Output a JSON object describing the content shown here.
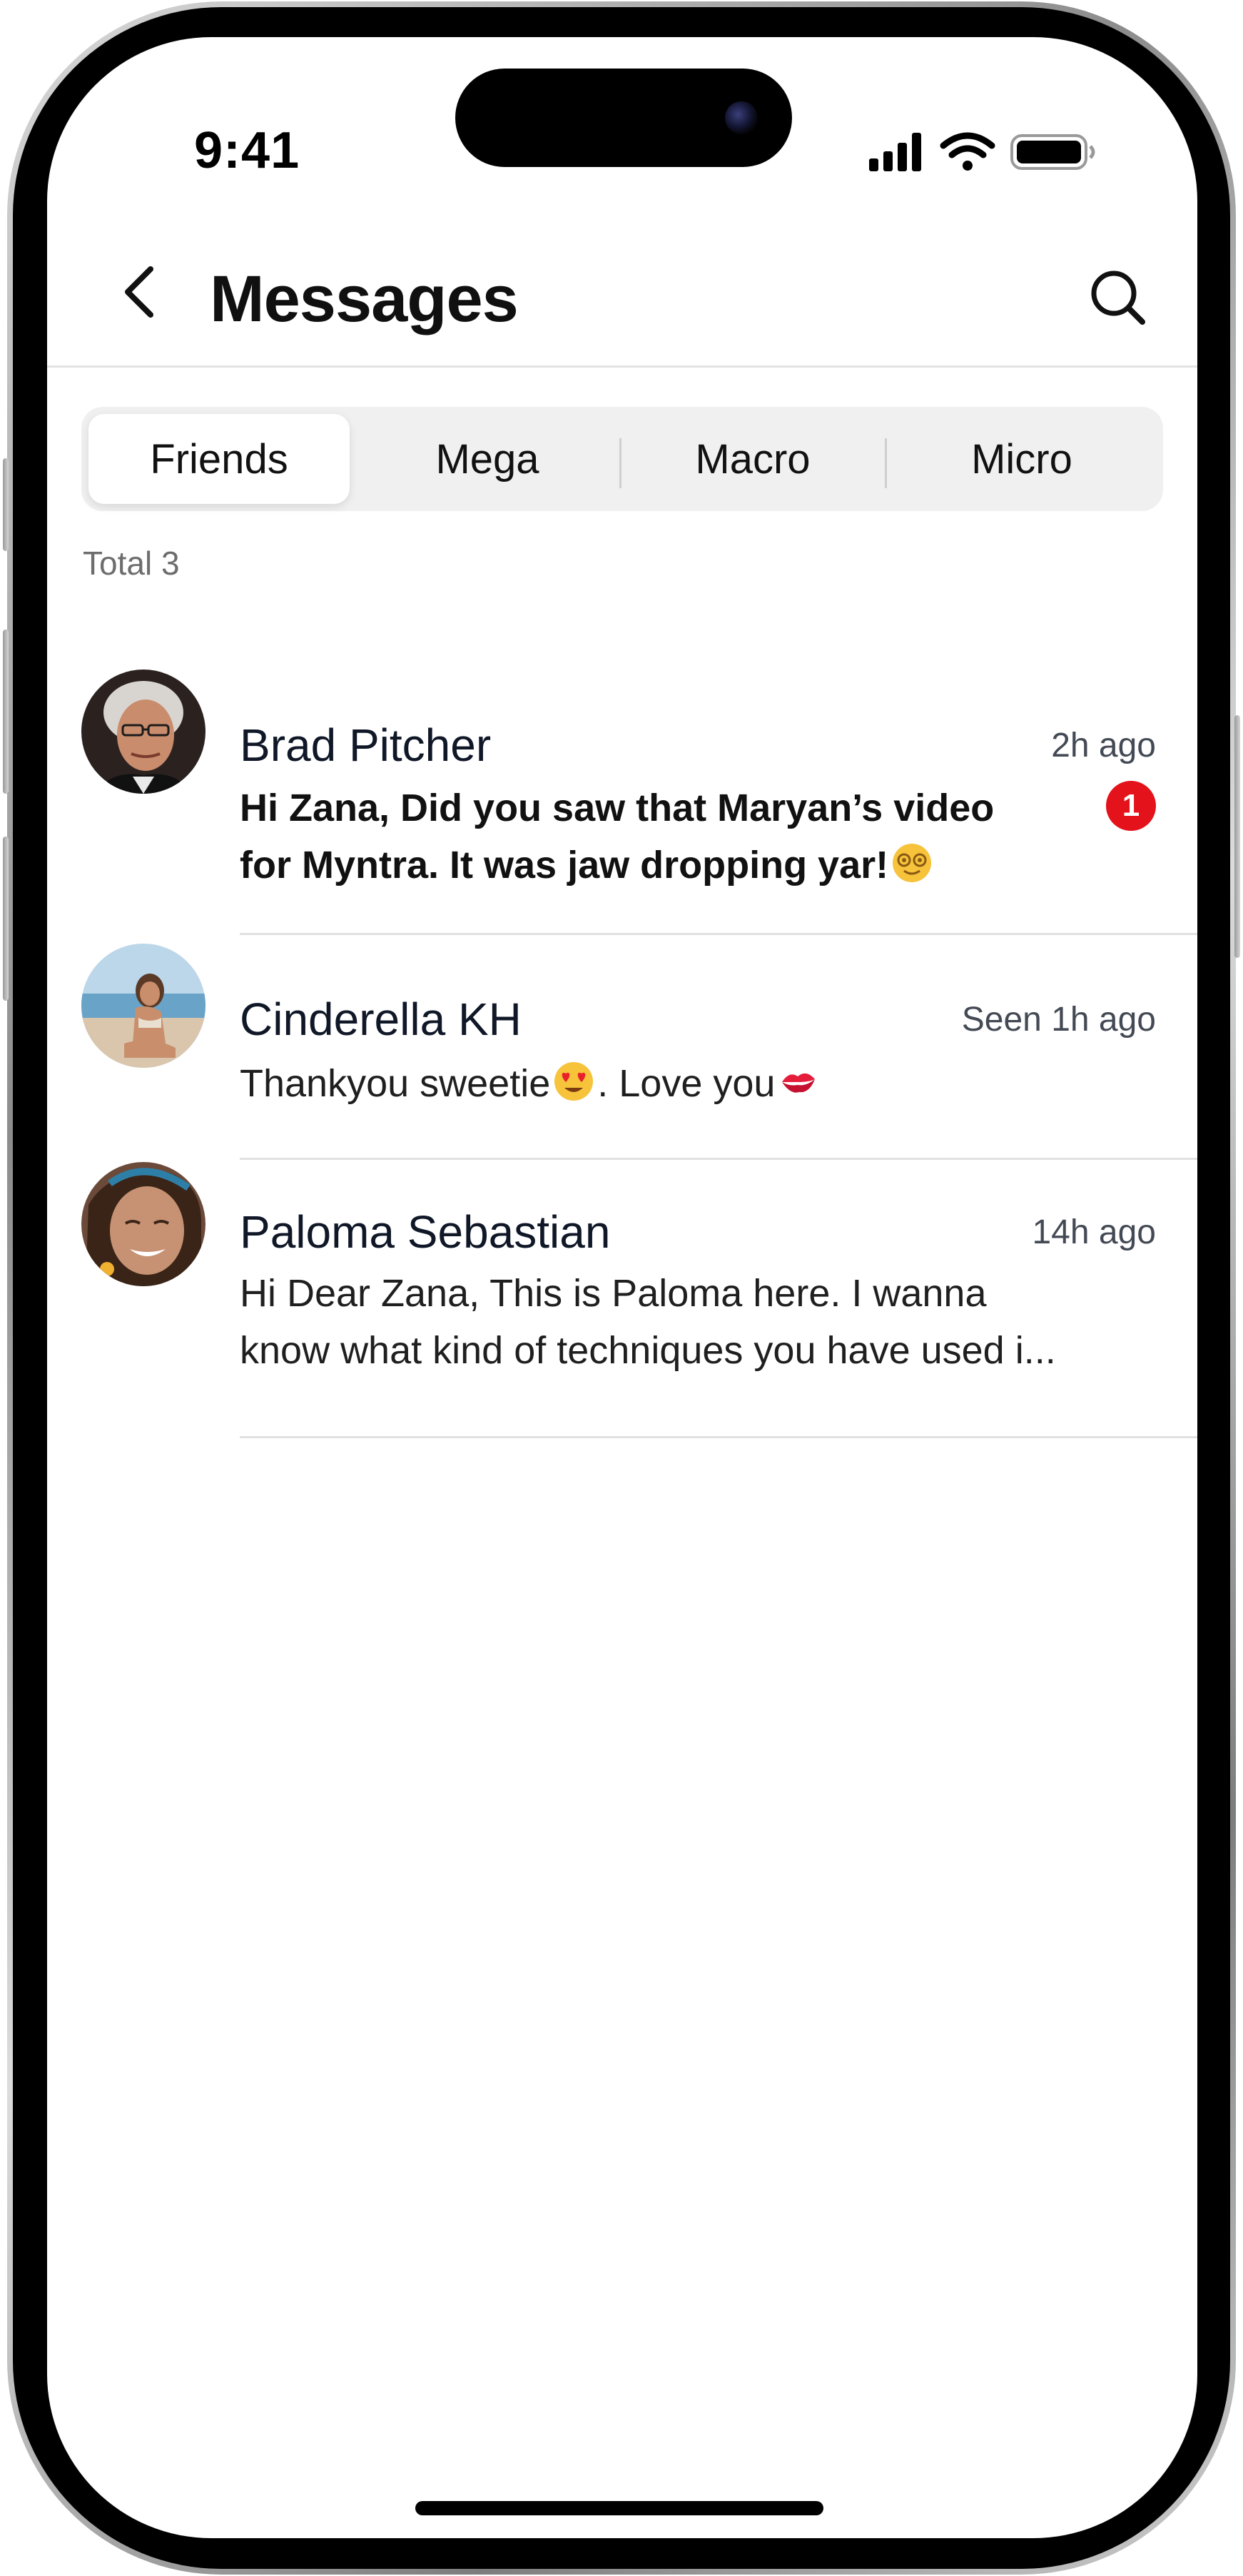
{
  "status_bar": {
    "time": "9:41",
    "signal_icon": "cellular-signal-icon",
    "wifi_icon": "wifi-icon",
    "battery_icon": "battery-icon"
  },
  "header": {
    "title": "Messages",
    "back_icon": "chevron-left-icon",
    "search_icon": "search-icon"
  },
  "tabs": [
    {
      "label": "Friends",
      "active": true
    },
    {
      "label": "Mega",
      "active": false
    },
    {
      "label": "Macro",
      "active": false
    },
    {
      "label": "Micro",
      "active": false
    }
  ],
  "total_label": "Total 3",
  "conversations": [
    {
      "name": "Brad Pitcher",
      "time": "2h ago",
      "preview_lines": [
        "Hi Zana, Did you saw that Maryan’s video",
        "for Myntra. It was jaw dropping yar!"
      ],
      "unread": true,
      "unread_count": "1",
      "emoji": "hypnotized-face-emoji"
    },
    {
      "name": "Cinderella KH",
      "time": "Seen 1h ago",
      "preview_lines": [
        "Thankyou sweetie",
        ". Love you"
      ],
      "unread": false,
      "emoji": [
        "heart-eyes-emoji",
        "kiss-mark-emoji"
      ]
    },
    {
      "name": "Paloma Sebastian",
      "time": "14h ago",
      "preview_lines": [
        "Hi Dear Zana, This is Paloma here. I wanna",
        "know what kind of techniques you have used i..."
      ],
      "unread": false
    }
  ],
  "colors": {
    "accent_badge": "#E4121B",
    "segment_bg": "#F0F0F0",
    "divider": "#E1E1E1",
    "muted_text": "#6D6D6D"
  }
}
